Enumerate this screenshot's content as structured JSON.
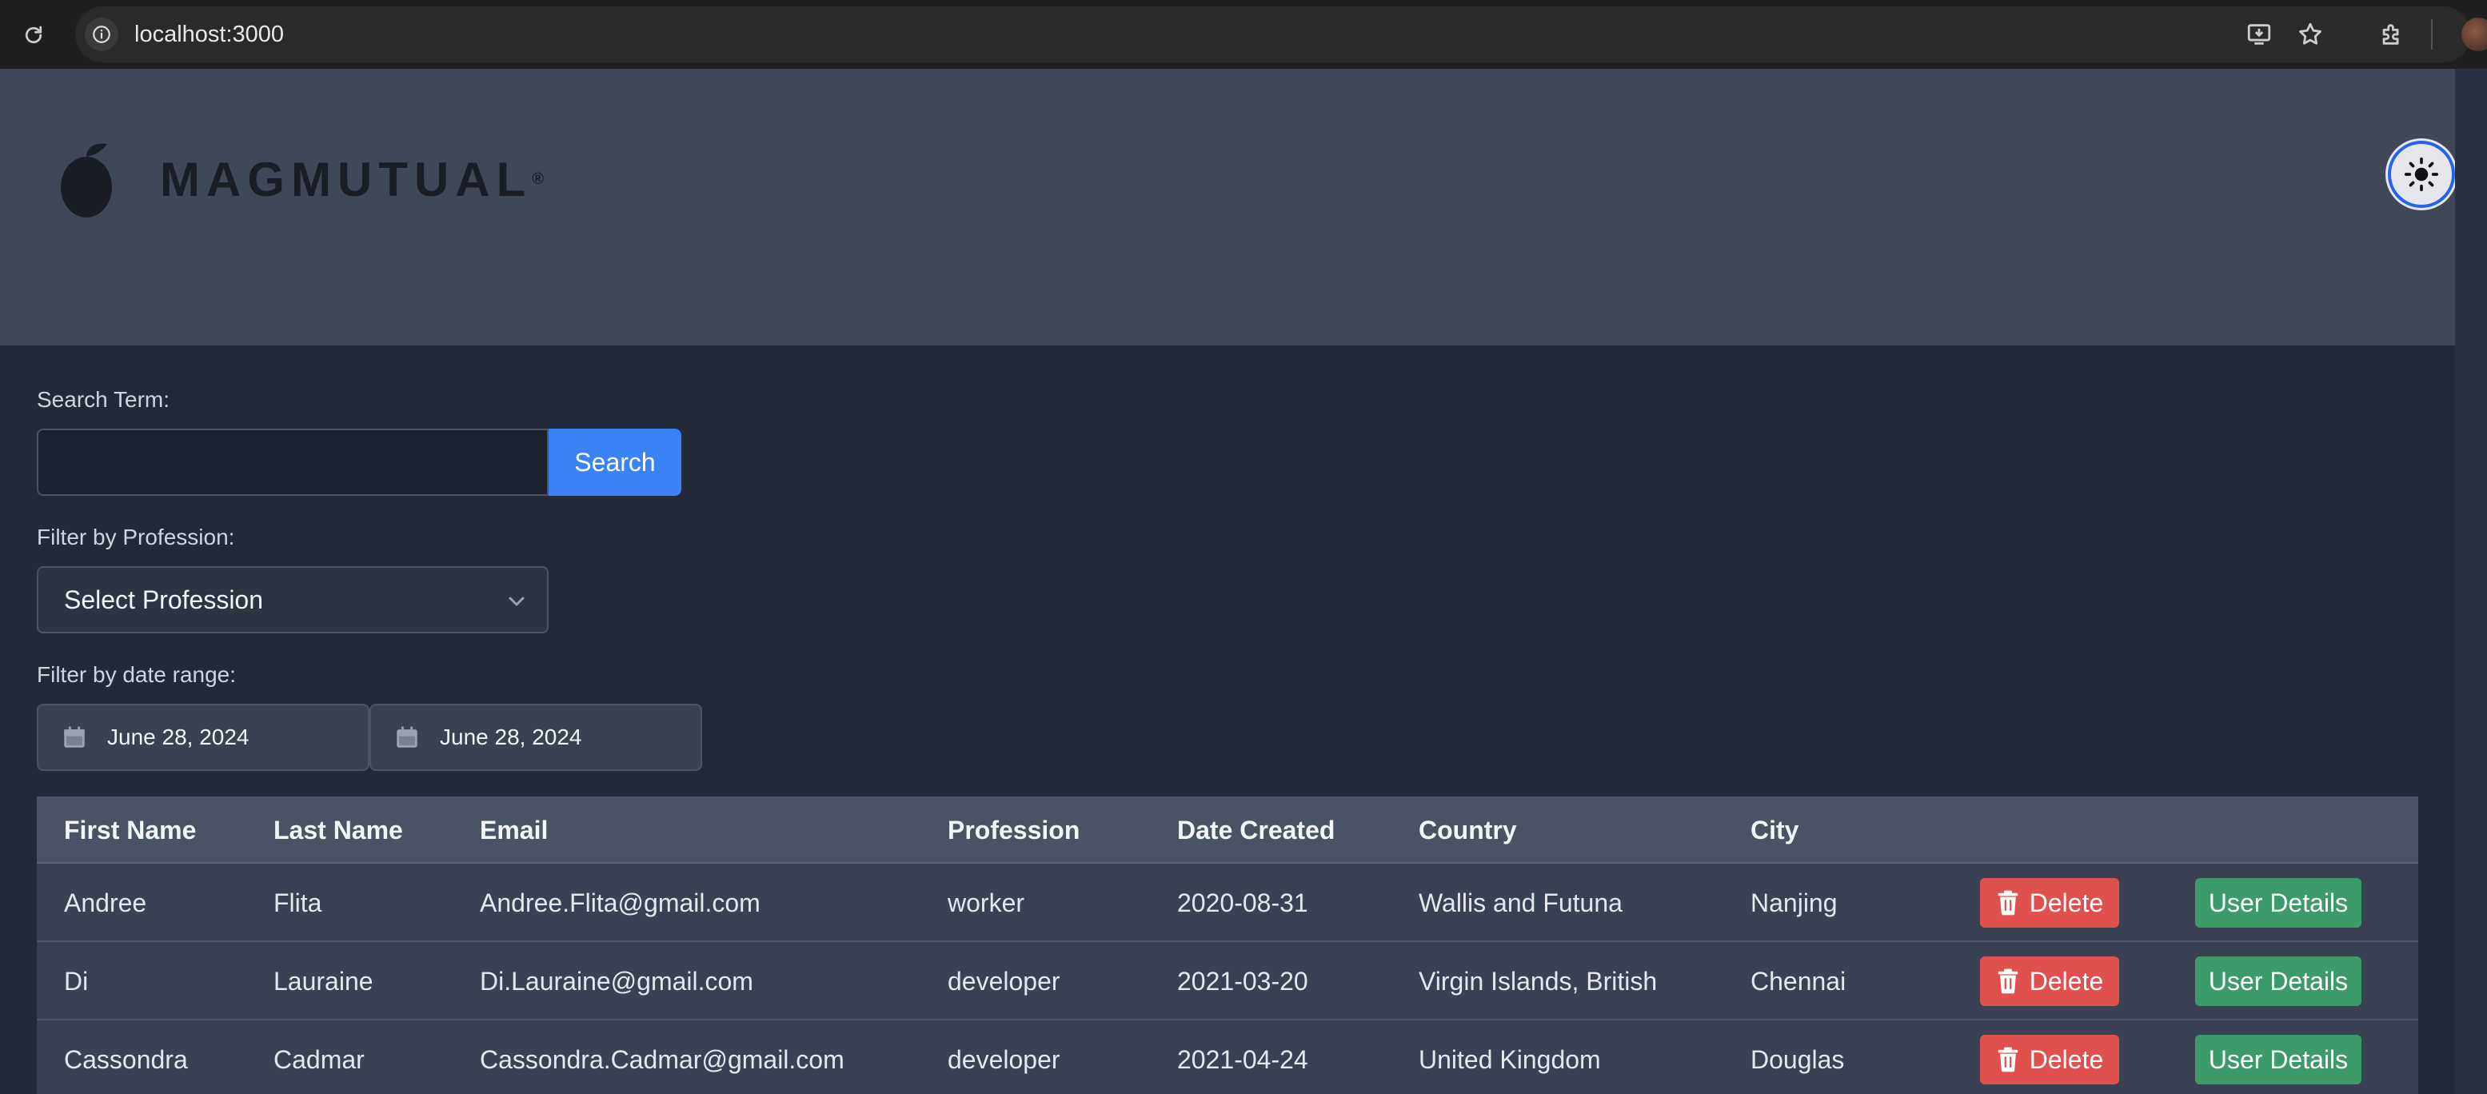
{
  "browser": {
    "url": "localhost:3000",
    "icons": [
      "reload-icon",
      "site-info-icon",
      "install-icon",
      "star-icon",
      "extensions-icon",
      "profile-avatar"
    ]
  },
  "header": {
    "logo_text": "MAGMUTUAL",
    "logo_reg": "®",
    "theme_toggle_icon": "sun-icon"
  },
  "filters": {
    "search_label": "Search Term:",
    "search_value": "",
    "search_button": "Search",
    "profession_label": "Filter by Profession:",
    "profession_selected": "Select Profession",
    "date_label": "Filter by date range:",
    "date_start": "June 28, 2024",
    "date_end": "June 28, 2024"
  },
  "table": {
    "headers": [
      "First Name",
      "Last Name",
      "Email",
      "Profession",
      "Date Created",
      "Country",
      "City"
    ],
    "rows": [
      {
        "first": "Andree",
        "last": "Flita",
        "email": "Andree.Flita@gmail.com",
        "profession": "worker",
        "date": "2020-08-31",
        "country": "Wallis and Futuna",
        "city": "Nanjing"
      },
      {
        "first": "Di",
        "last": "Lauraine",
        "email": "Di.Lauraine@gmail.com",
        "profession": "developer",
        "date": "2021-03-20",
        "country": "Virgin Islands, British",
        "city": "Chennai"
      },
      {
        "first": "Cassondra",
        "last": "Cadmar",
        "email": "Cassondra.Cadmar@gmail.com",
        "profession": "developer",
        "date": "2021-04-24",
        "country": "United Kingdom",
        "city": "Douglas"
      }
    ],
    "delete_label": "Delete",
    "details_label": "User Details"
  },
  "colors": {
    "header_bg": "#404858",
    "page_bg": "#222938",
    "primary": "#3b82f6",
    "danger": "#e0504f",
    "success": "#3d9b6a"
  }
}
